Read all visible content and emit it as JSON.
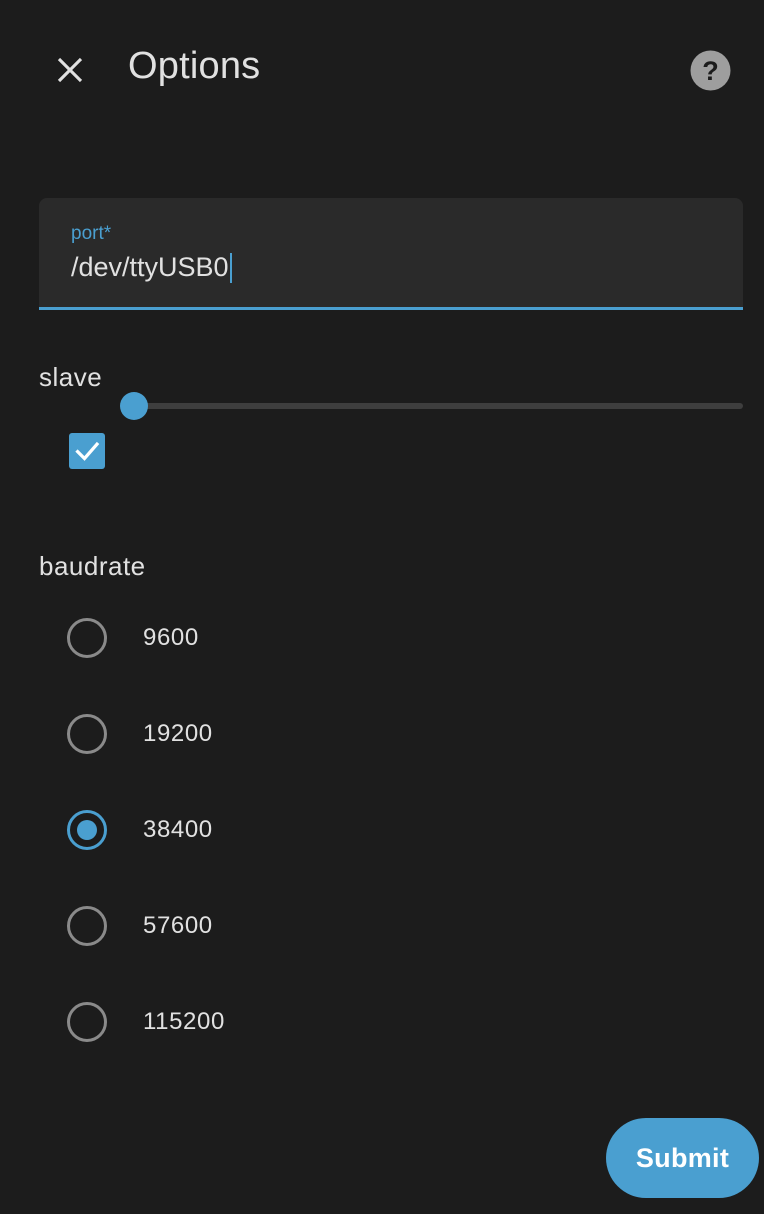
{
  "header": {
    "title": "Options",
    "close_icon": "close-icon",
    "help_icon": "help-circle-icon"
  },
  "port_field": {
    "label": "port*",
    "value": "/dev/ttyUSB0"
  },
  "slave": {
    "label": "slave",
    "slider_value_fraction": 0.0,
    "checkbox_checked": true
  },
  "baudrate": {
    "label": "baudrate",
    "options": [
      {
        "label": "9600",
        "checked": false
      },
      {
        "label": "19200",
        "checked": false
      },
      {
        "label": "38400",
        "checked": true
      },
      {
        "label": "57600",
        "checked": false
      },
      {
        "label": "115200",
        "checked": false
      }
    ]
  },
  "actions": {
    "submit_label": "Submit"
  },
  "colors": {
    "background": "#1c1c1c",
    "accent": "#4a9fd0",
    "field_bg": "#2a2a2a",
    "text": "#e1e1e1",
    "radio_unchecked": "#8a8a8a"
  }
}
